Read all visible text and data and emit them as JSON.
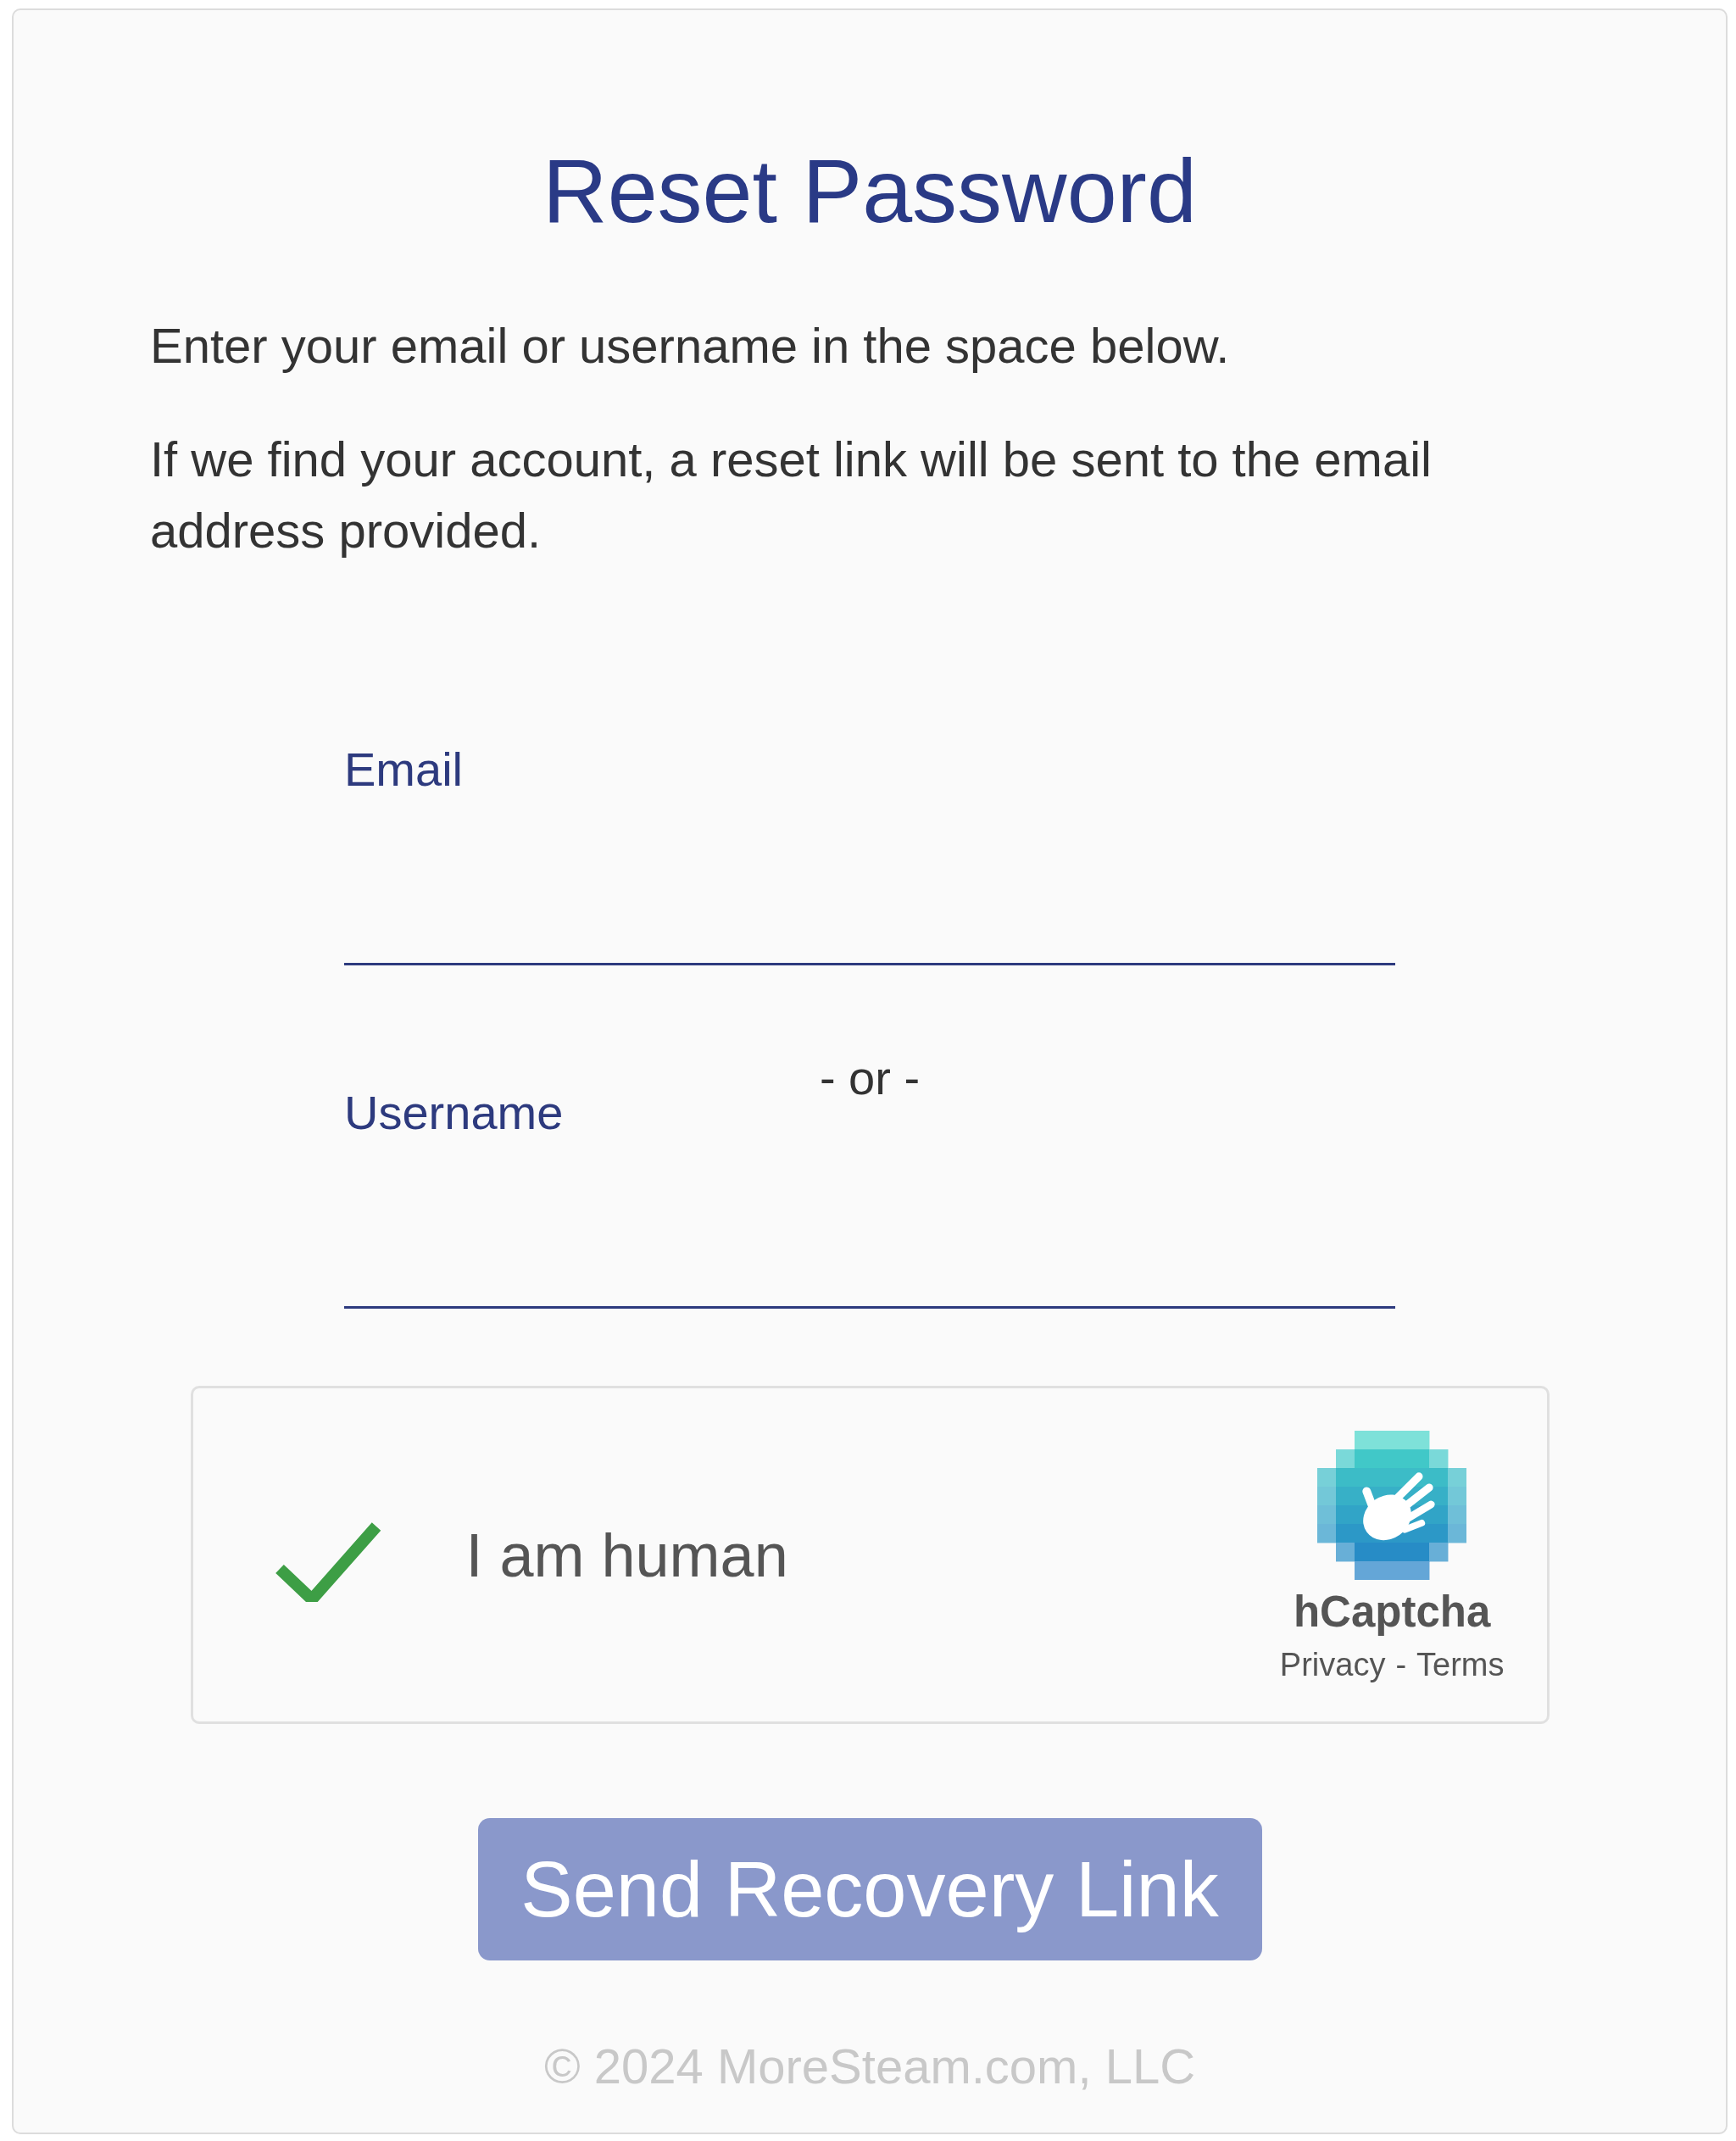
{
  "heading": "Reset Password",
  "instructions": [
    "Enter your email or username in the space below.",
    "If we find your account, a reset link will be sent to the email address provided."
  ],
  "fields": [
    {
      "label": "Email"
    },
    {
      "label": "Username"
    }
  ],
  "separator": "- or -",
  "captcha": {
    "checked": true,
    "label": "I am human",
    "brand": "hCaptcha",
    "links": [
      "Privacy",
      "Terms"
    ],
    "link_separator": "-"
  },
  "submit_button": "Send Recovery Link",
  "footer": "© 2024 MoreSteam.com, LLC"
}
